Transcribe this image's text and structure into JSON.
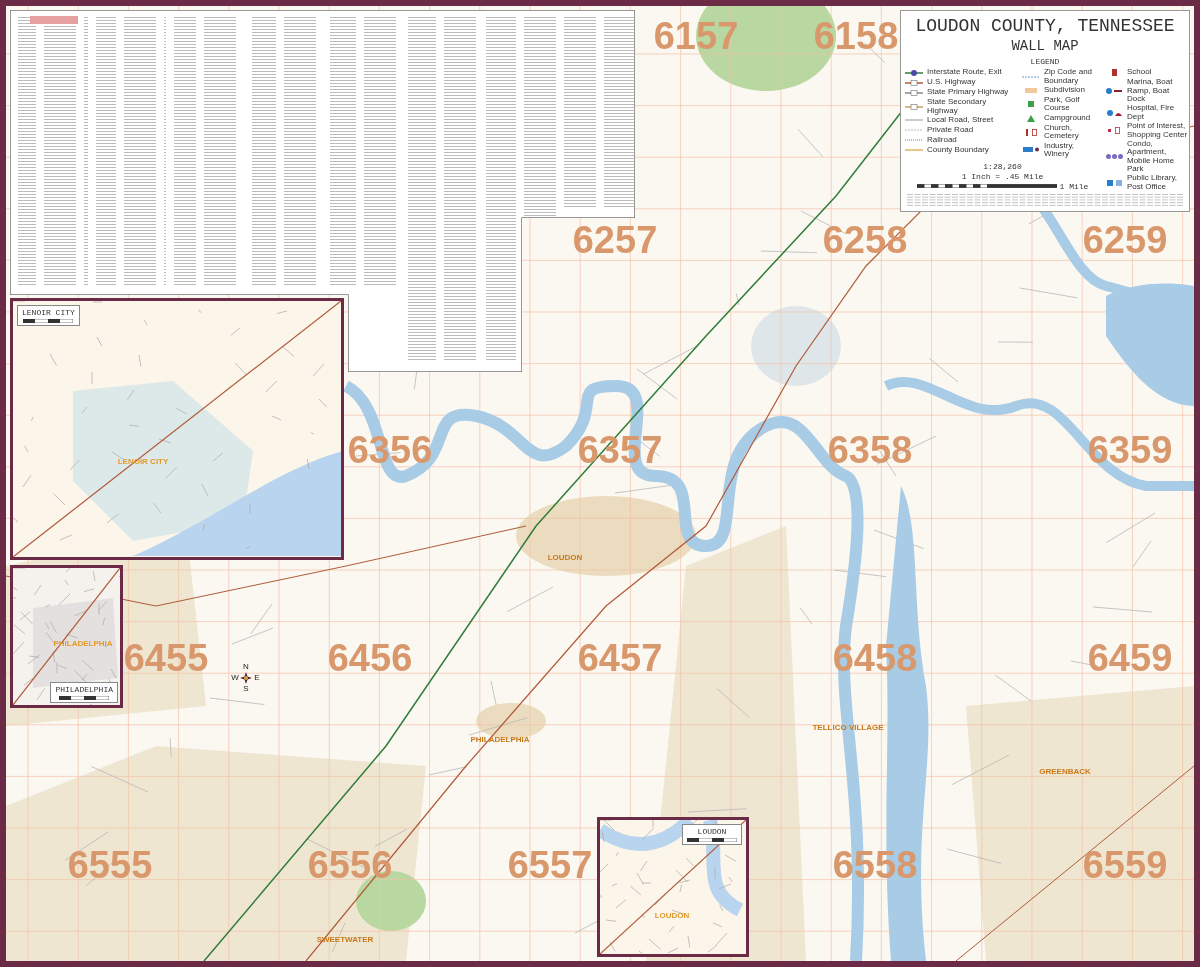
{
  "legend_box": {
    "title": "LOUDON COUNTY, TENNESSEE",
    "subtitle": "WALL MAP",
    "heading": "LEGEND",
    "columns": [
      [
        {
          "label": "Interstate Route, Exit",
          "kind": "interstate"
        },
        {
          "label": "U.S. Highway",
          "kind": "us_highway"
        },
        {
          "label": "State Primary Highway",
          "kind": "state_primary"
        },
        {
          "label": "State Secondary Highway",
          "kind": "state_secondary"
        },
        {
          "label": "Local Road, Street",
          "kind": "local_road"
        },
        {
          "label": "Private Road",
          "kind": "private_road"
        },
        {
          "label": "Railroad",
          "kind": "railroad"
        },
        {
          "label": "County Boundary",
          "kind": "county_boundary"
        }
      ],
      [
        {
          "label": "Zip Code and Boundary",
          "kind": "zip"
        },
        {
          "label": "Subdivision",
          "kind": "subdivision"
        },
        {
          "label": "Park, Golf Course",
          "kind": "park"
        },
        {
          "label": "Campground",
          "kind": "campground"
        },
        {
          "label": "Church, Cemetery",
          "kind": "church"
        },
        {
          "label": "Industry, Winery",
          "kind": "industry"
        }
      ],
      [
        {
          "label": "School",
          "kind": "school"
        },
        {
          "label": "Marina, Boat Ramp, Boat Dock",
          "kind": "marina"
        },
        {
          "label": "Hospital, Fire Dept",
          "kind": "hospital"
        },
        {
          "label": "Point of Interest, Shopping Center",
          "kind": "poi"
        },
        {
          "label": "Condo, Apartment, Mobile Home Park",
          "kind": "condo"
        },
        {
          "label": "Public Library, Post Office",
          "kind": "library"
        }
      ]
    ],
    "scale": {
      "ratio": "1:28,260",
      "inch": "1 Inch = .45 Mile",
      "end": "1 Mile"
    }
  },
  "sections": [
    {
      "label": "6157"
    },
    {
      "label": "6158"
    },
    {
      "label": "6257"
    },
    {
      "label": "6258"
    },
    {
      "label": "6259"
    },
    {
      "label": "6356"
    },
    {
      "label": "6357"
    },
    {
      "label": "6358"
    },
    {
      "label": "6359"
    },
    {
      "label": "6455"
    },
    {
      "label": "6456"
    },
    {
      "label": "6457"
    },
    {
      "label": "6458"
    },
    {
      "label": "6459"
    },
    {
      "label": "6555"
    },
    {
      "label": "6556"
    },
    {
      "label": "6557"
    },
    {
      "label": "6558"
    },
    {
      "label": "6559"
    }
  ],
  "places": [
    {
      "label": "LOUDON"
    },
    {
      "label": "PHILADELPHIA"
    },
    {
      "label": "TELLICO VILLAGE"
    },
    {
      "label": "GREENBACK"
    },
    {
      "label": "SWEETWATER"
    }
  ],
  "compass": [
    "N",
    "E",
    "S",
    "W"
  ],
  "insets": [
    {
      "title": "LENOIR CITY",
      "town": "LENOIR CITY"
    },
    {
      "title": "PHILADELPHIA",
      "town": "PHILADELPHIA"
    },
    {
      "title": "LOUDON",
      "town": "LOUDON"
    }
  ]
}
